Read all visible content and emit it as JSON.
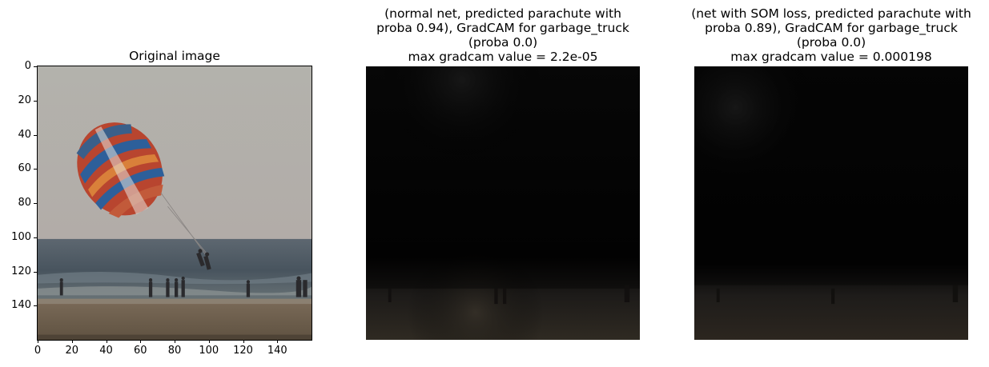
{
  "panels": [
    {
      "id": "original",
      "title_lines": [
        "Original image"
      ],
      "show_axes": true
    },
    {
      "id": "normal-net",
      "title_lines": [
        "(normal net, predicted parachute with",
        "proba 0.94), GradCAM for garbage_truck",
        "(proba 0.0)",
        "max gradcam value = 2.2e-05"
      ],
      "show_axes": false
    },
    {
      "id": "som-net",
      "title_lines": [
        "(net with SOM loss, predicted parachute with",
        "proba 0.89), GradCAM for garbage_truck",
        "(proba 0.0)",
        "max gradcam value = 0.000198"
      ],
      "show_axes": false
    }
  ],
  "axes": {
    "x_ticks": [
      "0",
      "20",
      "40",
      "60",
      "80",
      "100",
      "120",
      "140"
    ],
    "y_ticks": [
      "0",
      "20",
      "40",
      "60",
      "80",
      "100",
      "120",
      "140"
    ],
    "x_range": [
      0,
      160
    ],
    "y_range": [
      0,
      160
    ]
  },
  "colors": {
    "sky": "#b2b0aa",
    "sea": "#4a5560",
    "sand": "#6b5d4c",
    "canopy_red": "#b8452f",
    "canopy_blue": "#2d5f9a",
    "canopy_orange": "#d9803a",
    "heatmap_base": "#000000"
  }
}
